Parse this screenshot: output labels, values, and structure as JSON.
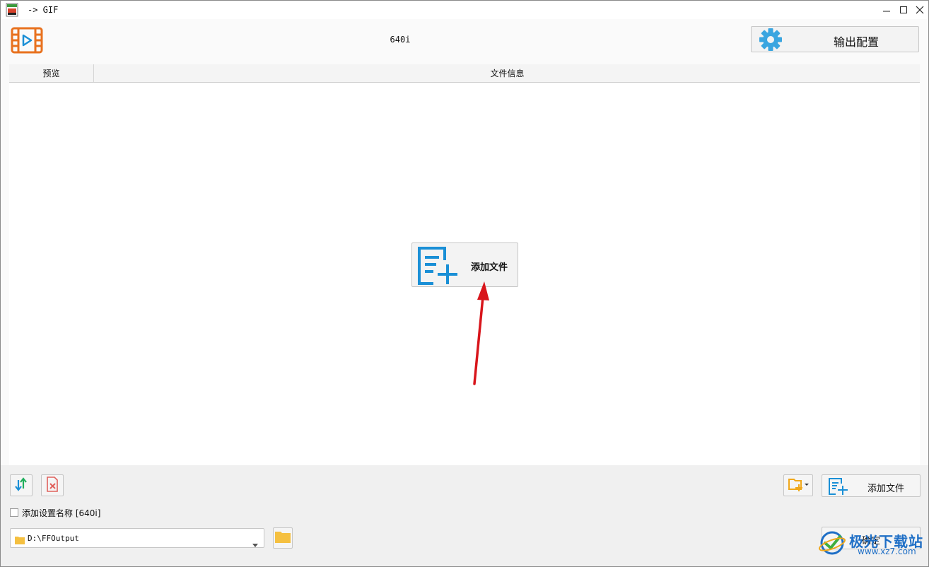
{
  "window": {
    "title": "-> GIF",
    "controls": {
      "minimize": "minimize-icon",
      "maximize": "maximize-icon",
      "close": "close-icon"
    }
  },
  "header": {
    "preset_name": "640i",
    "output_config_label": "输出配置"
  },
  "list": {
    "columns": [
      "预览",
      "文件信息"
    ],
    "center_add_label": "添加文件"
  },
  "bottom": {
    "add_file_label": "添加文件",
    "add_preset_name_label": "添加设置名称 [640i]",
    "add_preset_name_checked": false,
    "output_path": "D:\\FFOutput",
    "ok_label": "确定"
  },
  "watermark": {
    "text": "极光下载站",
    "sub": "www.xz7.com"
  },
  "colors": {
    "accent_orange": "#e8711e",
    "accent_blue": "#1a8fd6",
    "gear_blue": "#3aa5e0",
    "arrow_red": "#d8151b"
  }
}
